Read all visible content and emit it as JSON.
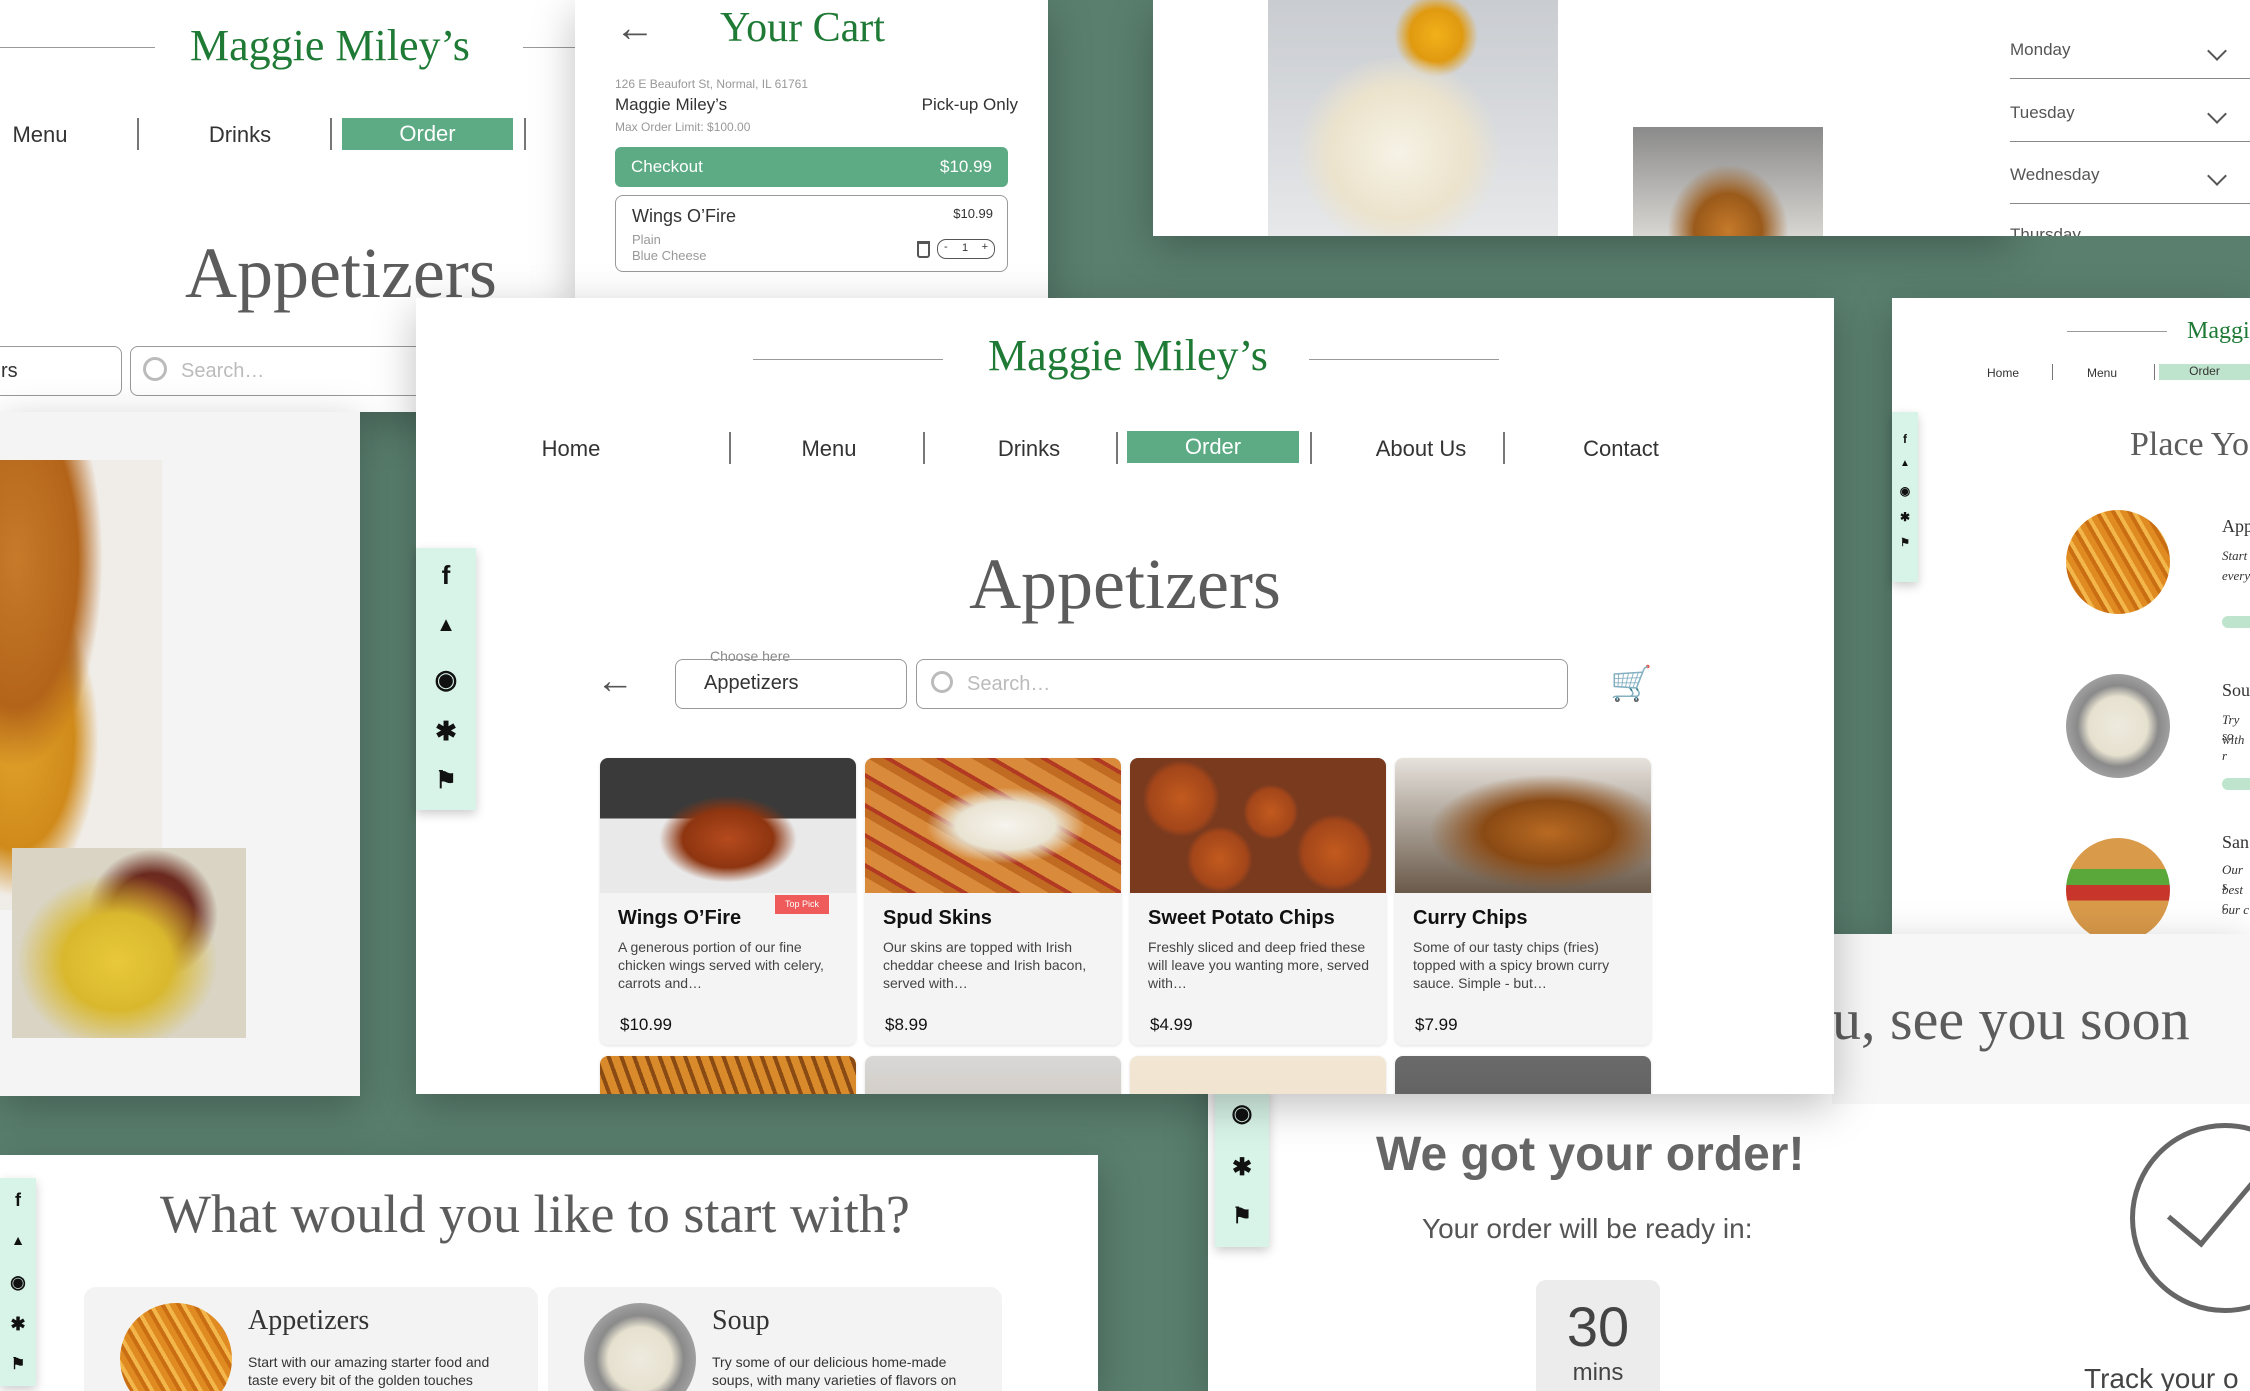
{
  "brand": "Maggie Miley’s",
  "colors": {
    "accent": "#5cab84",
    "brand_green": "#1e7a35",
    "backdrop": "#5a7f6f",
    "social_bg": "#d8f4e9",
    "badge": "#ef5a5a"
  },
  "social_icons": [
    "facebook-icon",
    "twitter-icon",
    "instagram-icon",
    "yelp-icon",
    "foursquare-icon"
  ],
  "top_left": {
    "nav": [
      "Menu",
      "Drinks",
      "Order"
    ],
    "heading": "Appetizers",
    "dropdown_value": "rs",
    "search_placeholder": "Search…"
  },
  "cart": {
    "title": "Your Cart",
    "address": "126 E Beaufort St, Normal, IL 61761",
    "restaurant": "Maggie Miley’s",
    "pickup": "Pick-up Only",
    "max_limit": "Max Order Limit: $100.00",
    "checkout_label": "Checkout",
    "checkout_total": "$10.99",
    "item": {
      "name": "Wings O’Fire",
      "price": "$10.99",
      "option1": "Plain",
      "option2": "Blue Cheese",
      "qty": "1",
      "minus": "-",
      "plus": "+"
    }
  },
  "hours": {
    "days": [
      "Monday",
      "Tuesday",
      "Wednesday",
      "Thursday"
    ]
  },
  "main": {
    "nav": [
      "Home",
      "Menu",
      "Drinks",
      "Order",
      "About Us",
      "Contact"
    ],
    "active_nav": "Order",
    "heading": "Appetizers",
    "dropdown_label": "Choose here",
    "dropdown_value": "Appetizers",
    "search_placeholder": "Search…",
    "items": [
      {
        "name": "Wings O’Fire",
        "desc": "A generous portion of our fine chicken wings served with celery, carrots and…",
        "price": "$10.99",
        "badge": "Top Pick"
      },
      {
        "name": "Spud Skins",
        "desc": "Our skins are topped with Irish cheddar cheese and Irish bacon, served with…",
        "price": "$8.99",
        "badge": ""
      },
      {
        "name": "Sweet Potato Chips",
        "desc": "Freshly sliced and deep fried these will leave you wanting more, served with…",
        "price": "$4.99",
        "badge": ""
      },
      {
        "name": "Curry Chips",
        "desc": "Some of our tasty chips (fries) topped with a spicy brown curry sauce. Simple - but…",
        "price": "$7.99",
        "badge": ""
      }
    ]
  },
  "right_panel": {
    "brand": "Maggie",
    "nav": [
      "Home",
      "Menu",
      "Order"
    ],
    "heading": "Place Yo",
    "items": [
      {
        "title": "App",
        "line1": "Start",
        "line2": "every"
      },
      {
        "title": "Sou",
        "line1": "Try so",
        "line2": "with r"
      },
      {
        "title": "San",
        "line1": "Our s",
        "line2": "best c",
        "line3": "our c"
      }
    ]
  },
  "start_panel": {
    "heading": "What would you like to start with?",
    "cards": [
      {
        "title": "Appetizers",
        "desc": "Start with our amazing starter food and taste every bit of the golden touches"
      },
      {
        "title": "Soup",
        "desc": "Try some of our delicious home-made soups, with many varieties of flavors on"
      }
    ]
  },
  "confirm_panel": {
    "banner": "u, see you soon",
    "heading": "We got your order!",
    "subheading": "Your order will be ready in:",
    "minutes": "30",
    "unit": "mins",
    "track": "Track your o"
  }
}
